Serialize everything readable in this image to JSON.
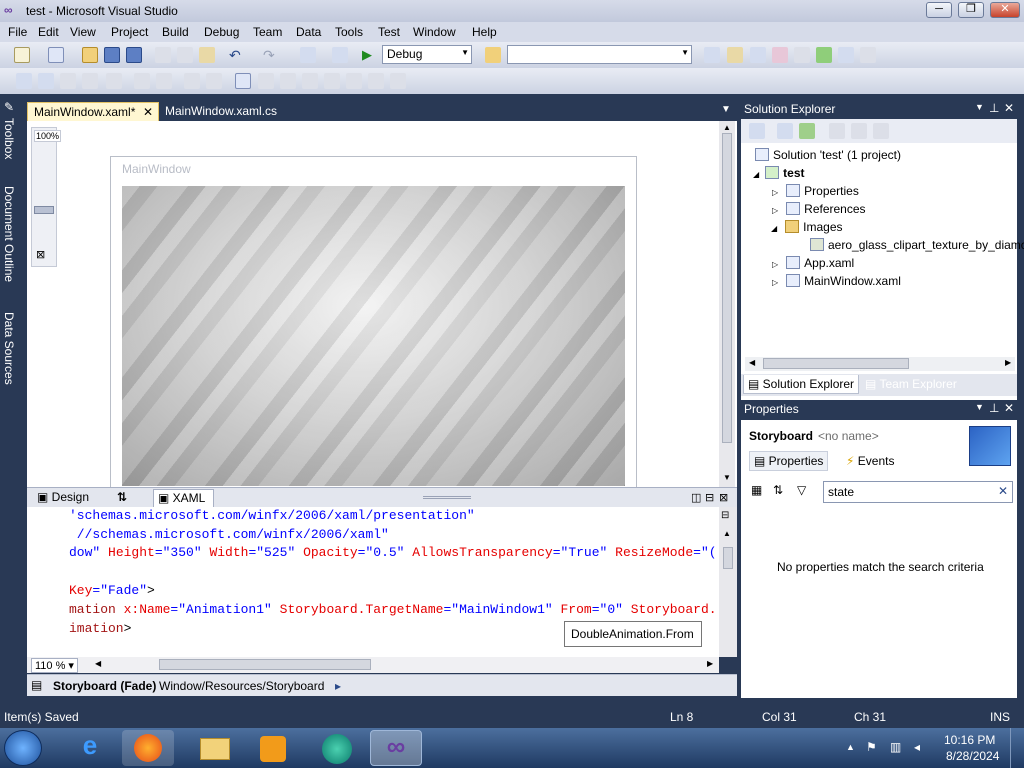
{
  "window": {
    "title": "test - Microsoft Visual Studio",
    "min": "─",
    "max": "❐",
    "close": "✕"
  },
  "menu": [
    "File",
    "Edit",
    "View",
    "Project",
    "Build",
    "Debug",
    "Team",
    "Data",
    "Tools",
    "Test",
    "Window",
    "Help"
  ],
  "toolbar": {
    "config_value": "Debug",
    "platform_value": ""
  },
  "left_tabs": [
    "Toolbox",
    "Document Outline",
    "Data Sources"
  ],
  "doc_tabs": [
    {
      "label": "MainWindow.xaml*",
      "active": true
    },
    {
      "label": "MainWindow.xaml.cs",
      "active": false
    }
  ],
  "designer": {
    "zoom_label": "100%",
    "window_title": "MainWindow"
  },
  "split_tabs": {
    "design": "Design",
    "swap": "⇅",
    "xaml": "XAML"
  },
  "code_lines": [
    {
      "parts": [
        [
          "val",
          "'schemas.microsoft.com/winfx/2006/xaml/presentation\""
        ]
      ]
    },
    {
      "parts": [
        [
          "val",
          " //schemas.microsoft.com/winfx/2006/xaml\""
        ]
      ]
    },
    {
      "parts": [
        [
          "val",
          "dow\" "
        ],
        [
          "at",
          "Height"
        ],
        [
          "val",
          "=\"350\" "
        ],
        [
          "at",
          "Width"
        ],
        [
          "val",
          "=\"525\" "
        ],
        [
          "at",
          "Opacity"
        ],
        [
          "val",
          "=\"0.5\" "
        ],
        [
          "at",
          "AllowsTransparency"
        ],
        [
          "val",
          "=\"True\" "
        ],
        [
          "at",
          "ResizeMode"
        ],
        [
          "val",
          "=\"("
        ]
      ]
    },
    {
      "parts": [
        [
          "plain",
          ""
        ]
      ]
    },
    {
      "parts": [
        [
          "at",
          "Key"
        ],
        [
          "val",
          "=\"Fade\""
        ],
        [
          "plain",
          ">"
        ]
      ]
    },
    {
      "parts": [
        [
          "kw",
          "mation "
        ],
        [
          "at",
          "x:Name"
        ],
        [
          "val",
          "=\"Animation1\" "
        ],
        [
          "at",
          "Storyboard.TargetName"
        ],
        [
          "val",
          "=\"MainWindow1\" "
        ],
        [
          "at",
          "From"
        ],
        [
          "val",
          "=\"0\" "
        ],
        [
          "at",
          "Storyboard."
        ]
      ]
    },
    {
      "parts": [
        [
          "kw",
          "imation"
        ],
        [
          "plain",
          ">"
        ]
      ]
    }
  ],
  "editor": {
    "zoom": "110 %",
    "tooltip": "DoubleAnimation.From"
  },
  "breadcrumb": {
    "item1": "Storyboard (Fade)",
    "item2": "Window/Resources/Storyboard",
    "arrow": "▸"
  },
  "solution_explorer": {
    "title": "Solution Explorer",
    "items": [
      {
        "label": "Solution 'test' (1 project)",
        "indent": 0,
        "exp": ""
      },
      {
        "label": "test",
        "indent": 1,
        "exp": "◢",
        "bold": true
      },
      {
        "label": "Properties",
        "indent": 2,
        "exp": "▷"
      },
      {
        "label": "References",
        "indent": 2,
        "exp": "▷"
      },
      {
        "label": "Images",
        "indent": 2,
        "exp": "◢"
      },
      {
        "label": "aero_glass_clipart_texture_by_diamc",
        "indent": 3,
        "exp": ""
      },
      {
        "label": "App.xaml",
        "indent": 2,
        "exp": "▷"
      },
      {
        "label": "MainWindow.xaml",
        "indent": 2,
        "exp": "▷"
      }
    ],
    "tab_se": "Solution Explorer",
    "tab_te": "Team Explorer"
  },
  "properties": {
    "title": "Properties",
    "object_type": "Storyboard",
    "object_name": "<no name>",
    "tab_props": "Properties",
    "tab_events": "Events",
    "search_value": "state",
    "empty_msg": "No properties match the search criteria"
  },
  "status": {
    "message": "Item(s) Saved",
    "ln": "Ln 8",
    "col": "Col 31",
    "ch": "Ch 31",
    "mode": "INS"
  },
  "clock": {
    "time": "10:16 PM",
    "date": "8/28/2024"
  }
}
